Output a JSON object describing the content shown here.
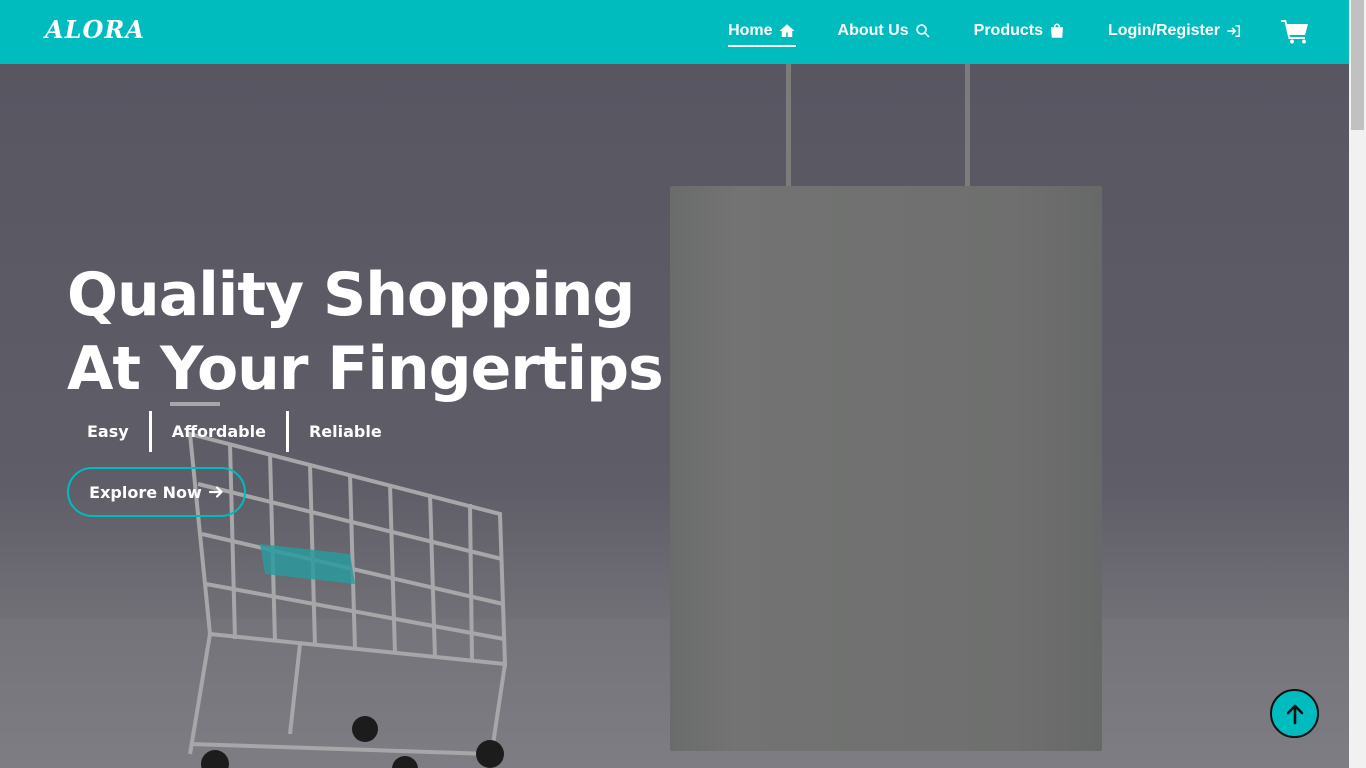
{
  "brand": {
    "logo": "ALORA",
    "accent": "#00bcbf"
  },
  "nav": {
    "items": [
      {
        "label": "Home",
        "icon": "home-icon",
        "active": true
      },
      {
        "label": "About Us",
        "icon": "search-icon",
        "active": false
      },
      {
        "label": "Products",
        "icon": "shopping-bag-icon",
        "active": false
      },
      {
        "label": "Login/Register",
        "icon": "sign-in-icon",
        "active": false
      }
    ],
    "cart_icon": "cart-icon"
  },
  "hero": {
    "headline": "Quality Shopping At Your Fingertips",
    "features": [
      "Easy",
      "Affordable",
      "Reliable"
    ],
    "cta_label": "Explore Now",
    "cta_icon": "arrow-right-icon"
  },
  "scroll_top_icon": "arrow-up-icon"
}
